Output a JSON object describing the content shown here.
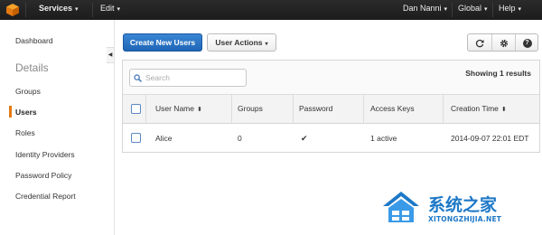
{
  "topbar": {
    "services_label": "Services",
    "edit_label": "Edit",
    "user_label": "Dan Nanni",
    "region_label": "Global",
    "help_label": "Help"
  },
  "sidebar": {
    "dashboard": "Dashboard",
    "heading": "Details",
    "items": [
      {
        "label": "Groups"
      },
      {
        "label": "Users",
        "active": true
      },
      {
        "label": "Roles"
      },
      {
        "label": "Identity Providers"
      },
      {
        "label": "Password Policy"
      },
      {
        "label": "Credential Report"
      }
    ]
  },
  "toolbar": {
    "create_label": "Create New Users",
    "actions_label": "User Actions",
    "icons": [
      "refresh-icon",
      "gear-icon",
      "help-icon"
    ]
  },
  "table": {
    "search_placeholder": "Search",
    "search_value": "",
    "showing": "Showing 1 results",
    "columns": [
      "User Name",
      "Groups",
      "Password",
      "Access Keys",
      "Creation Time"
    ],
    "rows": [
      {
        "user_name": "Alice",
        "groups": "0",
        "password": true,
        "access_keys": "1 active",
        "creation_time": "2014-09-07 22:01 EDT"
      }
    ]
  },
  "watermark": {
    "brand": "系统之家",
    "url": "XITONGZHIJIA.NET",
    "accent": "#1d78c7"
  },
  "colors": {
    "primary": "#1f66b5",
    "active_marker": "#e47911",
    "topbar": "#222222"
  }
}
